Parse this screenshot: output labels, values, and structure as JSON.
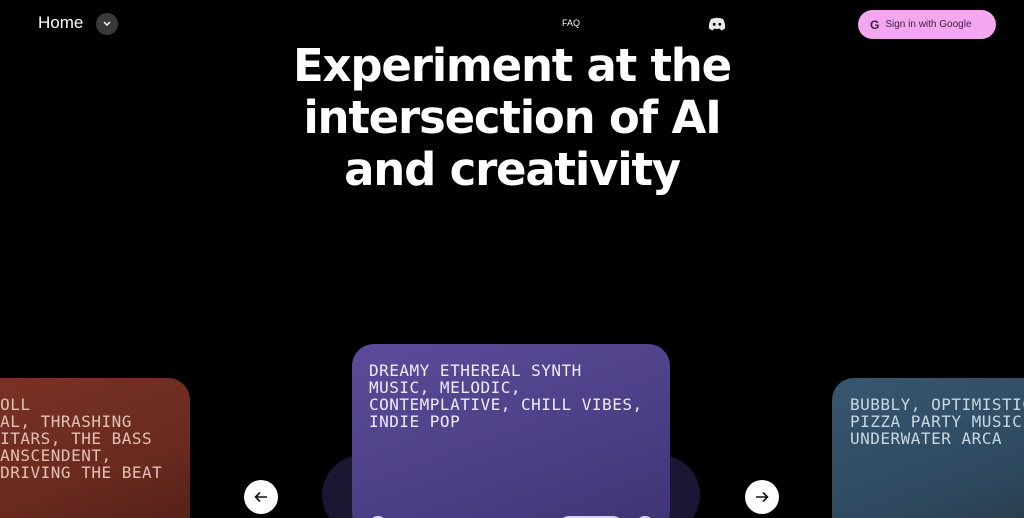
{
  "nav": {
    "home_label": "Home",
    "faq_label": "FAQ",
    "signin_g": "G",
    "signin_label": "Sign in with Google"
  },
  "hero": {
    "line1": "Experiment at the",
    "line2": "intersection of AI",
    "line3": "and creativity"
  },
  "cards": {
    "left": "ROLL\nTAL, THRASHING\nUITARS, THE BASS\nRANSCENDENT,\n DRIVING THE BEAT",
    "center": "DREAMY ETHEREAL SYNTH\nMUSIC, MELODIC,\nCONTEMPLATIVE, CHILL VIBES,\nINDIE POP",
    "right": "BUBBLY, OPTIMISTIC\nPIZZA PARTY MUSIC\nUNDERWATER ARCA"
  },
  "colors": {
    "background": "#000000",
    "signin_bg": "#f4a6f0",
    "card_left": "#6a2a1f",
    "card_center": "#4d3f86",
    "card_right": "#2f4a60"
  },
  "icons": {
    "home_dropdown": "chevron-down-icon",
    "discord": "discord-icon",
    "google": "google-icon",
    "prev": "arrow-left-icon",
    "next": "arrow-right-icon"
  }
}
